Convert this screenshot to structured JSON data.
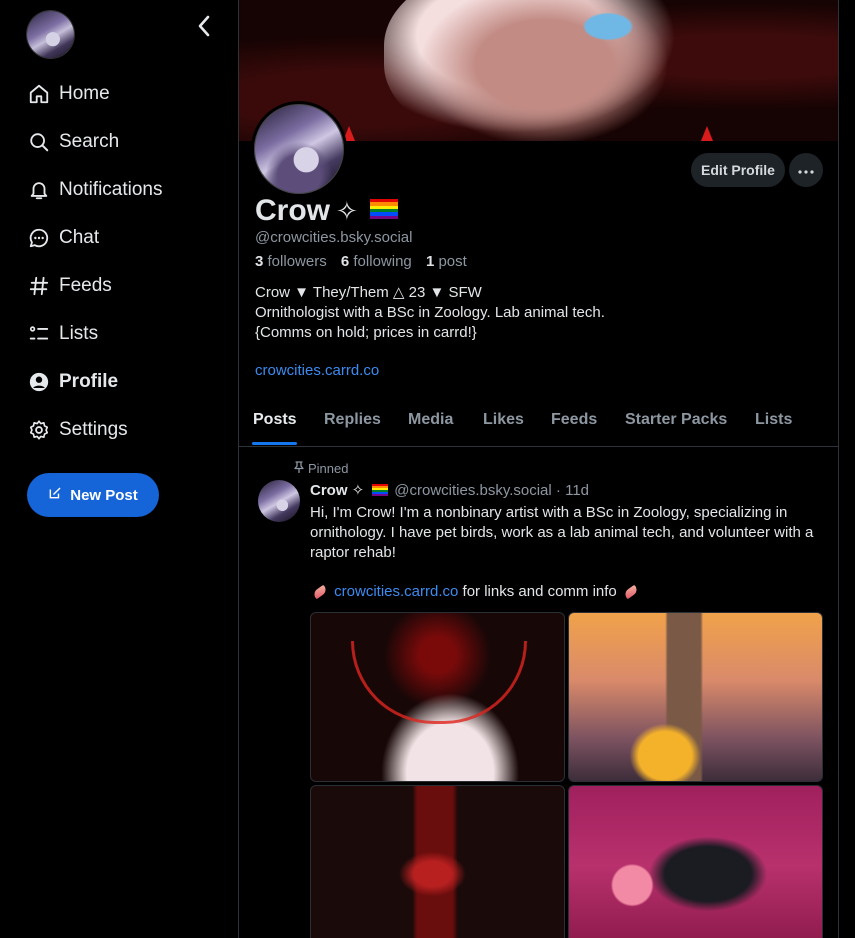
{
  "sidebar": {
    "nav": [
      {
        "label": "Home",
        "icon": "home-icon"
      },
      {
        "label": "Search",
        "icon": "search-icon"
      },
      {
        "label": "Notifications",
        "icon": "bell-icon"
      },
      {
        "label": "Chat",
        "icon": "chat-icon"
      },
      {
        "label": "Feeds",
        "icon": "hash-icon"
      },
      {
        "label": "Lists",
        "icon": "list-icon"
      },
      {
        "label": "Profile",
        "icon": "user-icon",
        "active": true
      },
      {
        "label": "Settings",
        "icon": "gear-icon"
      }
    ],
    "new_post_label": "New Post"
  },
  "profile": {
    "display_name": "Crow",
    "name_emoji": "✧",
    "handle": "@crowcities.bsky.social",
    "followers_count": "3",
    "followers_label": "followers",
    "following_count": "6",
    "following_label": "following",
    "posts_count": "1",
    "posts_label": "post",
    "bio_lines": [
      "Crow ▼ They/Them △ 23 ▼ SFW",
      "Ornithologist with a BSc in Zoology. Lab animal tech.",
      "{Comms on hold; prices in carrd!}"
    ],
    "bio_link": "crowcities.carrd.co",
    "edit_profile_label": "Edit Profile"
  },
  "tabs": [
    "Posts",
    "Replies",
    "Media",
    "Likes",
    "Feeds",
    "Starter Packs",
    "Lists"
  ],
  "post": {
    "pinned_label": "Pinned",
    "author": "Crow ✧",
    "handle": "@crowcities.bsky.social",
    "time": "· 11d",
    "text": "Hi, I'm Crow! I'm a nonbinary artist with a BSc in Zoology, specializing in ornithology. I have pet birds, work as a lab animal tech, and volunteer with a raptor rehab!",
    "link_text": "crowcities.carrd.co",
    "link_suffix": " for links and comm info "
  },
  "colors": {
    "accent": "#1565d8",
    "link": "#3d8bf0",
    "muted": "#8d97a1",
    "background": "#000000"
  }
}
